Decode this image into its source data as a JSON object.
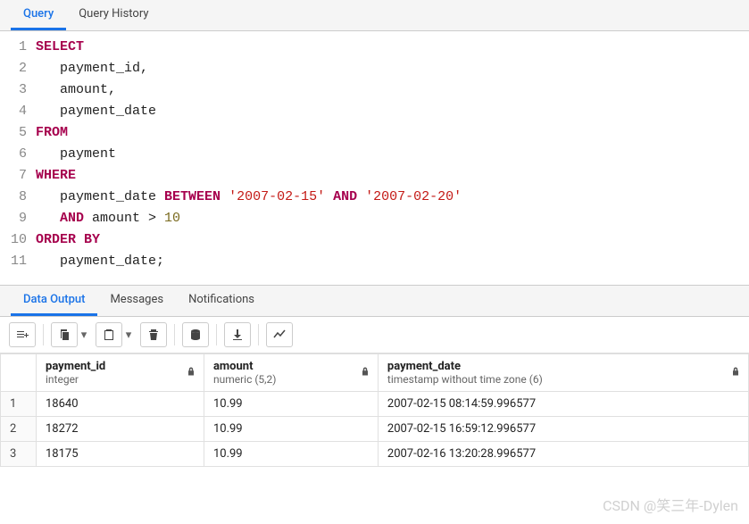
{
  "top_tabs": {
    "query": "Query",
    "history": "Query History"
  },
  "sql": {
    "lines": [
      [
        {
          "t": "SELECT",
          "c": "kw"
        }
      ],
      [
        {
          "t": "   ",
          "c": "ident"
        },
        {
          "t": "payment_id,",
          "c": "ident"
        }
      ],
      [
        {
          "t": "   ",
          "c": "ident"
        },
        {
          "t": "amount,",
          "c": "ident"
        }
      ],
      [
        {
          "t": "   ",
          "c": "ident"
        },
        {
          "t": "payment_date",
          "c": "ident"
        }
      ],
      [
        {
          "t": "FROM",
          "c": "kw"
        }
      ],
      [
        {
          "t": "   ",
          "c": "ident"
        },
        {
          "t": "payment",
          "c": "ident"
        }
      ],
      [
        {
          "t": "WHERE",
          "c": "kw"
        }
      ],
      [
        {
          "t": "   ",
          "c": "ident"
        },
        {
          "t": "payment_date ",
          "c": "ident"
        },
        {
          "t": "BETWEEN",
          "c": "kw"
        },
        {
          "t": " ",
          "c": "ident"
        },
        {
          "t": "'2007-02-15'",
          "c": "str"
        },
        {
          "t": " ",
          "c": "ident"
        },
        {
          "t": "AND",
          "c": "kw"
        },
        {
          "t": " ",
          "c": "ident"
        },
        {
          "t": "'2007-02-20'",
          "c": "str"
        }
      ],
      [
        {
          "t": "   ",
          "c": "ident"
        },
        {
          "t": "AND",
          "c": "kw"
        },
        {
          "t": " amount > ",
          "c": "ident"
        },
        {
          "t": "10",
          "c": "num"
        }
      ],
      [
        {
          "t": "ORDER BY",
          "c": "kw"
        }
      ],
      [
        {
          "t": "   ",
          "c": "ident"
        },
        {
          "t": "payment_date;",
          "c": "ident"
        }
      ]
    ]
  },
  "panel_tabs": {
    "data_output": "Data Output",
    "messages": "Messages",
    "notifications": "Notifications"
  },
  "columns": [
    {
      "name": "payment_id",
      "type": "integer",
      "align": "right"
    },
    {
      "name": "amount",
      "type": "numeric (5,2)",
      "align": "right"
    },
    {
      "name": "payment_date",
      "type": "timestamp without time zone (6)",
      "align": "left"
    }
  ],
  "rows": [
    {
      "n": "1",
      "payment_id": "18640",
      "amount": "10.99",
      "payment_date": "2007-02-15 08:14:59.996577"
    },
    {
      "n": "2",
      "payment_id": "18272",
      "amount": "10.99",
      "payment_date": "2007-02-15 16:59:12.996577"
    },
    {
      "n": "3",
      "payment_id": "18175",
      "amount": "10.99",
      "payment_date": "2007-02-16 13:20:28.996577"
    }
  ],
  "watermark": "CSDN @笑三年-Dylen"
}
